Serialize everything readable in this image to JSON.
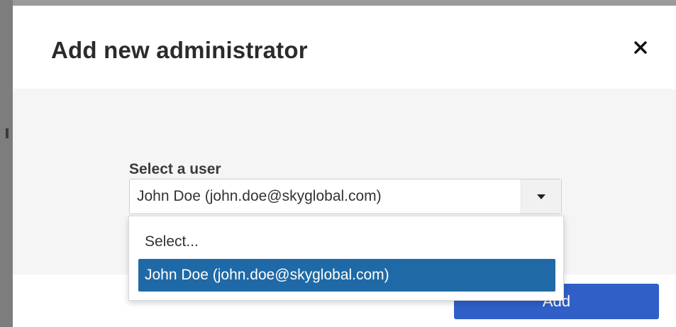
{
  "dialog": {
    "title": "Add new administrator",
    "close_icon": "close-icon"
  },
  "form": {
    "user_select": {
      "label": "Select a user",
      "selected_value": "John Doe (john.doe@skyglobal.com)",
      "arrow_icon": "caret-down-icon",
      "options": [
        "Select...",
        "John Doe (john.doe@skyglobal.com)"
      ],
      "highlighted_option_index": 1
    }
  },
  "footer": {
    "add_label": "Add"
  },
  "colors": {
    "primary_button": "#2f5fc7",
    "highlight": "#1f6aa6",
    "body_background": "#f5f5f6"
  }
}
